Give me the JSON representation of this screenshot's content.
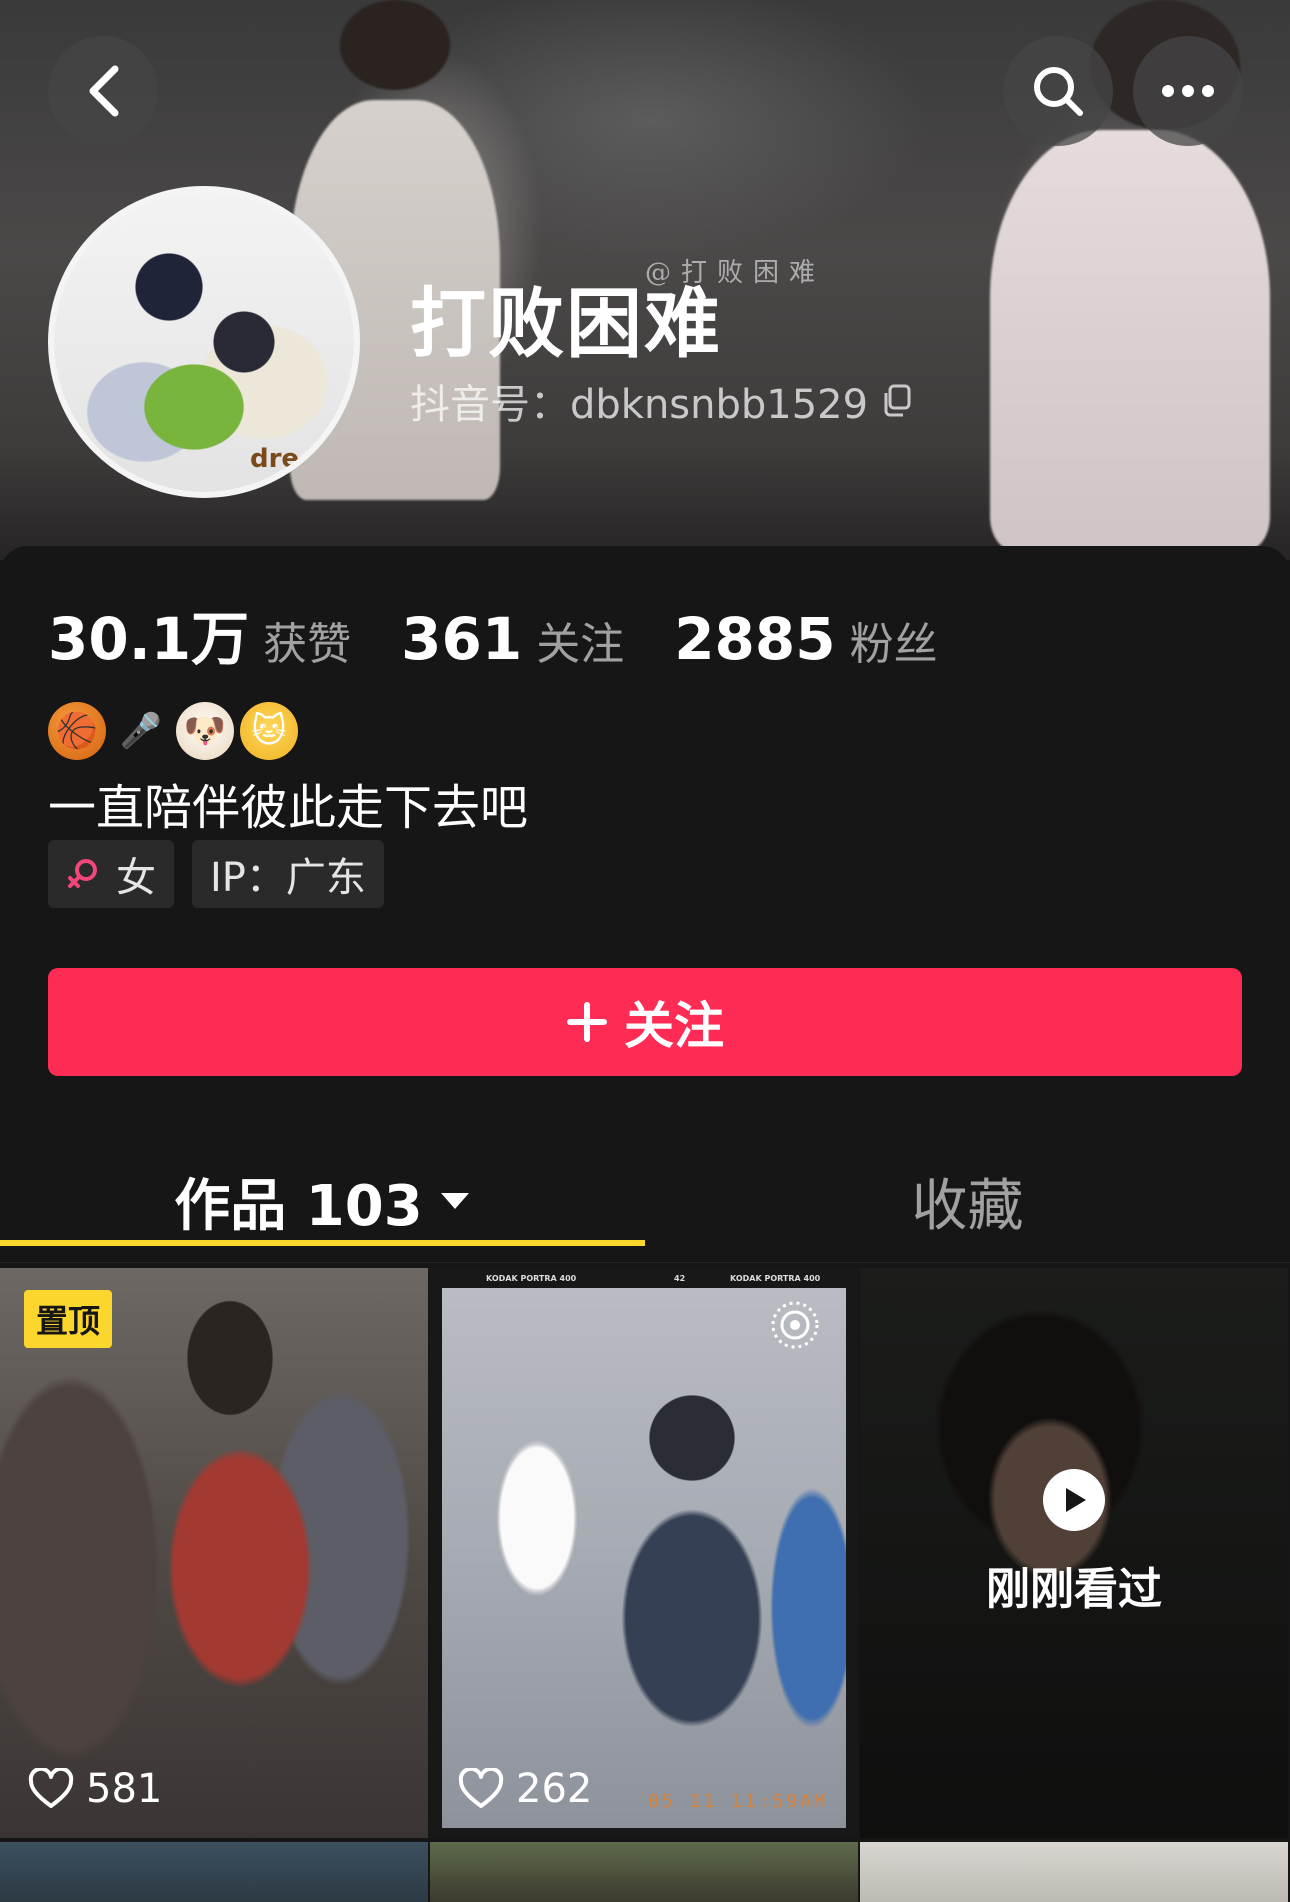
{
  "header": {
    "watermark": "@打败困难",
    "avatar_text": "dre"
  },
  "profile": {
    "nickname": "打败困难",
    "douyin_id": "抖音号：dbknsnbb1529"
  },
  "stats": [
    {
      "value": "30.1万",
      "label": "获赞"
    },
    {
      "value": "361",
      "label": "关注"
    },
    {
      "value": "2885",
      "label": "粉丝"
    }
  ],
  "bio": {
    "emojis": [
      "🏀",
      "🎤",
      "🐶",
      "🐱"
    ],
    "text": "一直陪伴彼此走下去吧"
  },
  "tags": {
    "gender": "女",
    "ip": "IP：广东"
  },
  "follow_button": {
    "label": "关注"
  },
  "tabs": {
    "works": "作品 103",
    "favorites": "收藏"
  },
  "videos": [
    {
      "badge": "置顶",
      "likes": "581"
    },
    {
      "likes": "262",
      "film_brand": "KODAK PORTRA 400",
      "frame": "42",
      "date_stamp": "05 11 11:59AM"
    },
    {
      "overlay_text": "刚刚看过"
    }
  ]
}
